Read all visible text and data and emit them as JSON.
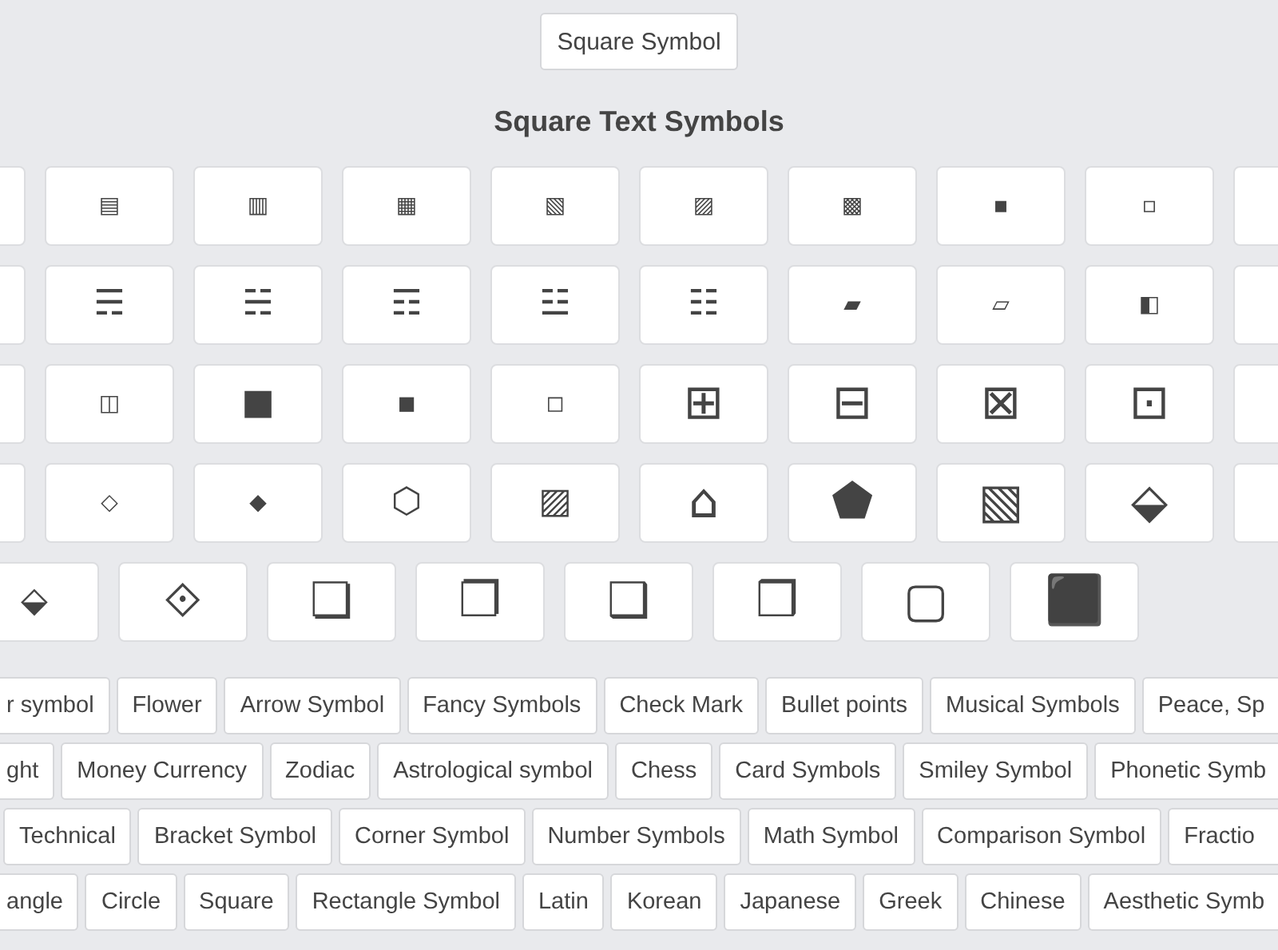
{
  "top_button": "Square Symbol",
  "title": "Square Text Symbols",
  "symbol_rows": [
    {
      "cut_left": true,
      "cut_right": true,
      "symbols": [
        {
          "kind": "small",
          "text": "▤"
        },
        {
          "kind": "small",
          "text": "▥"
        },
        {
          "kind": "small",
          "text": "▦"
        },
        {
          "kind": "small",
          "text": "▧"
        },
        {
          "kind": "small",
          "text": "▨"
        },
        {
          "kind": "small",
          "text": "▩"
        },
        {
          "kind": "small",
          "text": "▪"
        },
        {
          "kind": "small",
          "text": "▫"
        }
      ]
    },
    {
      "cut_left": true,
      "cut_right": true,
      "symbols": [
        {
          "kind": "medium",
          "text": "☴"
        },
        {
          "kind": "medium",
          "text": "☵"
        },
        {
          "kind": "medium",
          "text": "☶"
        },
        {
          "kind": "medium",
          "text": "☳"
        },
        {
          "kind": "medium",
          "text": "☷"
        },
        {
          "kind": "small",
          "text": "▰"
        },
        {
          "kind": "small",
          "text": "▱"
        },
        {
          "kind": "small",
          "text": "◧"
        }
      ]
    },
    {
      "cut_left": true,
      "cut_right": true,
      "symbols": [
        {
          "kind": "small",
          "text": "◫"
        },
        {
          "kind": "medium",
          "text": "■"
        },
        {
          "kind": "small",
          "text": "◼"
        },
        {
          "kind": "small",
          "text": "◻"
        },
        {
          "kind": "large",
          "text": "⊞"
        },
        {
          "kind": "large",
          "text": "⊟"
        },
        {
          "kind": "large",
          "text": "⊠"
        },
        {
          "kind": "large",
          "text": "⊡"
        }
      ]
    },
    {
      "cut_left": true,
      "cut_right": true,
      "symbols": [
        {
          "kind": "small",
          "text": "◇"
        },
        {
          "kind": "small",
          "text": "◆"
        },
        {
          "kind": "medium",
          "text": "⬡"
        },
        {
          "kind": "medium",
          "text": "▨"
        },
        {
          "kind": "large",
          "text": "⌂"
        },
        {
          "kind": "large",
          "text": "⬟"
        },
        {
          "kind": "large",
          "text": "▧"
        },
        {
          "kind": "large",
          "text": "⬙"
        }
      ]
    },
    {
      "symbols": [
        {
          "kind": "medium",
          "text": "⬙"
        },
        {
          "kind": "large",
          "text": "⟐"
        },
        {
          "kind": "large",
          "text": "❏"
        },
        {
          "kind": "large",
          "text": "❐"
        },
        {
          "kind": "large",
          "text": "❑"
        },
        {
          "kind": "large",
          "text": "❒"
        },
        {
          "kind": "large",
          "text": "▢"
        },
        {
          "kind": "large",
          "text": "⬛"
        }
      ]
    }
  ],
  "tag_rows": [
    [
      "r symbol",
      "Flower",
      "Arrow Symbol",
      "Fancy Symbols",
      "Check Mark",
      "Bullet points",
      "Musical Symbols",
      "Peace, Sp"
    ],
    [
      "ght",
      "Money Currency",
      "Zodiac",
      "Astrological symbol",
      "Chess",
      "Card Symbols",
      "Smiley Symbol",
      "Phonetic Symb"
    ],
    [
      "Technical",
      "Bracket Symbol",
      "Corner Symbol",
      "Number Symbols",
      "Math Symbol",
      "Comparison Symbol",
      "Fractio"
    ],
    [
      "angle",
      "Circle",
      "Square",
      "Rectangle Symbol",
      "Latin",
      "Korean",
      "Japanese",
      "Greek",
      "Chinese",
      "Aesthetic Symb"
    ]
  ]
}
